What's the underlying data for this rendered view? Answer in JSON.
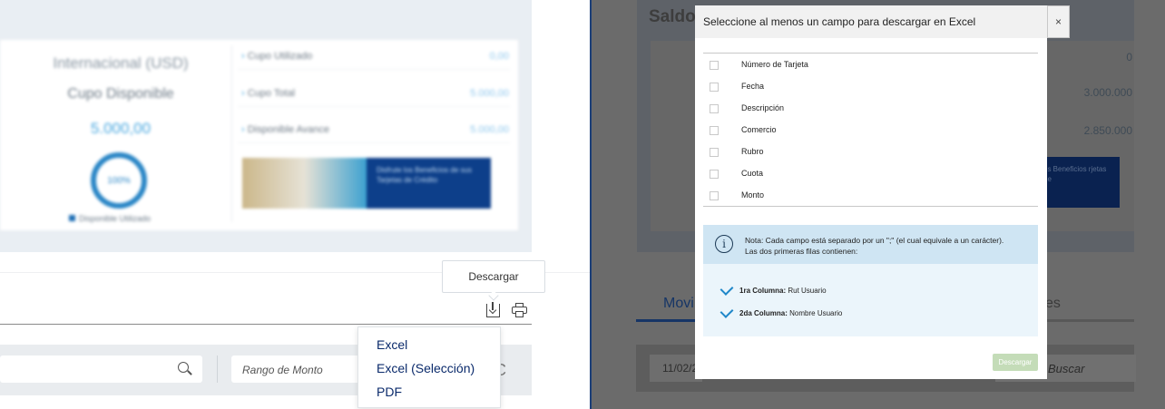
{
  "left": {
    "card": {
      "region": "Internacional (USD)",
      "label": "Cupo Disponible",
      "amount": "5.000,00",
      "ring_percent": "100%",
      "legend": "Disponible  Utilizado",
      "rows": [
        {
          "label": "Cupo Utilizado",
          "value": "0,00"
        },
        {
          "label": "Cupo Total",
          "value": "5.000,00"
        },
        {
          "label": "Disponible Avance",
          "value": "5.000,00"
        }
      ],
      "promo_text": "Disfrute los Beneficios de sus Tarjetas de Crédito"
    },
    "tooltip": "Descargar",
    "menu": [
      "Excel",
      "Excel (Selección)",
      "PDF"
    ],
    "range_placeholder": "Rango de Monto",
    "clear_glyph": "C"
  },
  "right_bg": {
    "saldo": "Saldo",
    "values": [
      "0",
      "3.000.000",
      "2.850.000"
    ],
    "promo_text": "os Beneficios rjetas de",
    "tab_active": "Movi",
    "tab_other": "es",
    "date": "11/02/2",
    "search": "Buscar"
  },
  "modal": {
    "title": "Seleccione al menos un campo para descargar en Excel",
    "close": "×",
    "fields": [
      "Número de Tarjeta",
      "Fecha",
      "Descripción",
      "Comercio",
      "Rubro",
      "Cuota",
      "Monto"
    ],
    "note_line1": "Nota: Cada campo está separado por un \";\" (el cual equivale a un carácter).",
    "note_line2": "Las dos primeras filas contienen:",
    "info_icon": "i",
    "columns": [
      {
        "label": "1ra Columna:",
        "value": "Rut Usuario"
      },
      {
        "label": "2da Columna:",
        "value": "Nombre Usuario"
      }
    ],
    "download": "Descargar"
  },
  "colors": {
    "accent": "#1f87c9",
    "brand_dark": "#0a2a6b",
    "note_bg": "#cfe5f3"
  }
}
